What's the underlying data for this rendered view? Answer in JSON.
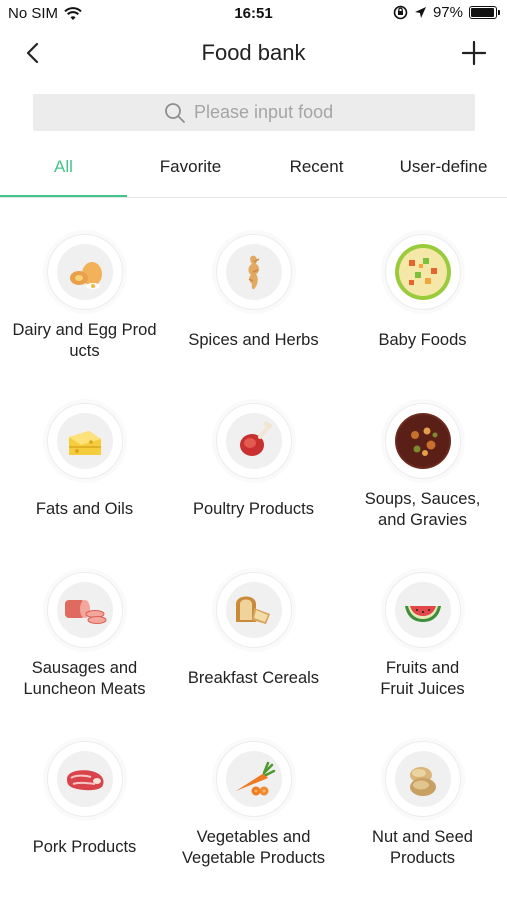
{
  "status_bar": {
    "carrier": "No SIM",
    "time": "16:51",
    "battery": "97%",
    "battery_level": 0.97
  },
  "nav": {
    "title": "Food bank"
  },
  "search": {
    "placeholder": "Please input food"
  },
  "tabs": [
    {
      "label": "All",
      "active": true
    },
    {
      "label": "Favorite",
      "active": false
    },
    {
      "label": "Recent",
      "active": false
    },
    {
      "label": "User-define",
      "active": false
    }
  ],
  "categories": [
    {
      "label": "Dairy and Egg Prod ucts",
      "line1": "Dairy and Egg Prod",
      "line2": "ucts",
      "icon": "eggs-icon"
    },
    {
      "label": "Spices and Herbs",
      "icon": "ginger-icon"
    },
    {
      "label": "Baby Foods",
      "icon": "baby-food-icon"
    },
    {
      "label": "Fats and Oils",
      "icon": "cheese-fat-icon"
    },
    {
      "label": "Poultry Products",
      "icon": "drumstick-icon"
    },
    {
      "label": "Soups, Sauces, and Gravies",
      "line1": "Soups, Sauces,",
      "line2": "and Gravies",
      "icon": "soup-icon"
    },
    {
      "label": "Sausages and Luncheon Meats",
      "line1": "Sausages and",
      "line2": "Luncheon Meats",
      "icon": "sausage-icon"
    },
    {
      "label": "Breakfast Cereals",
      "icon": "bread-icon"
    },
    {
      "label": "Fruits and Fruit Juices",
      "line1": "Fruits and",
      "line2": "Fruit Juices",
      "icon": "watermelon-icon"
    },
    {
      "label": "Pork Products",
      "icon": "pork-steak-icon"
    },
    {
      "label": "Vegetables and Vegetable Products",
      "line1": "Vegetables and",
      "line2": "Vegetable Products",
      "icon": "carrot-icon"
    },
    {
      "label": "Nut and Seed Products",
      "line1": "Nut and Seed",
      "line2": "Products",
      "icon": "nuts-icon"
    }
  ],
  "colors": {
    "accent": "#43c48a",
    "search_bg": "#ececec",
    "text": "#222222"
  }
}
